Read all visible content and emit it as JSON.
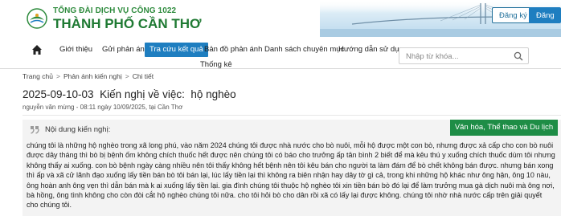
{
  "header": {
    "subtitle": "TỔNG ĐÀI DỊCH VỤ CÔNG 1022",
    "title": "THÀNH PHỐ CẦN THƠ",
    "register_label": "Đăng ký",
    "login_label": "Đăng"
  },
  "nav": {
    "items": [
      {
        "label": "Giới thiệu"
      },
      {
        "label": "Gửi phản ánh"
      },
      {
        "label": "Tra cứu kết quả"
      },
      {
        "label": "Bản đồ phản ánh"
      },
      {
        "label": "Danh sách chuyên mục"
      },
      {
        "label": "Hướng dẫn sử dụng"
      },
      {
        "label": "Thống kê"
      }
    ],
    "search_placeholder": "Nhập từ khóa..."
  },
  "breadcrumb": [
    "Trang chủ",
    "Phản ánh kiến nghị",
    "Chi tiết"
  ],
  "page": {
    "title": "2025-09-10-03  Kiến nghị về việc:  hộ nghèo",
    "meta": "nguyễn văn mừng - 08:11 ngày 10/09/2025, tại Cần Thơ"
  },
  "panel": {
    "label": "Nội dung kiến nghị:",
    "tag": "Văn hóa, Thể thao và Du lịch",
    "content": "chúng tôi là những hộ nghèo trong xã long phú, vào năm 2024 chúng tôi được nhà nước cho bò nuôi, mỗi hộ được một con bò, nhưng được xả cấp cho con bò nuôi được dây tháng thì bò bị bệnh ốm không chích thuốc hết được nên chúng tôi có báo cho trưởng ấp tân bình 2 biết để mà kêu thú y xuống chích thuốc dùm tôi nhưng không thấy ai xuống. con bò bệnh ngày càng nhiều nên tôi thấy không hết bệnh nên tôi kêu bán cho người ta làm đám để bò chết không bán được. nhưng bán xong thì ấp và xã cử lãnh đạo xuống lấy tiền bán bò tôi bán lại, lúc lấy tiền lại thì không ra biên nhận hay dây tờ gì cả, trong khi những hộ khác như ông hận, ông 10 nàu, ông hoàn anh ông vẹn thì dẫn bán mà k ai xuống lấy tiền lại. gia đình chúng tôi thuộc hộ nghèo tôi xin tiền bán bò đó lại để làm trưởng mua gà dịch nuôi mà ông nơi, bà hồng, ông tình không cho còn đòi cắt hộ nghèo chúng tôi nữa.  cho tôi hỏi bò cho dân rồi xã có lấy lại được không. chúng tôi nhờ nhà nước cấp trên giải quyết cho chúng tôi."
  },
  "colors": {
    "brand_green": "#1f7a33",
    "accent_blue": "#1e7ec0",
    "tag_green": "#1e8d46"
  }
}
